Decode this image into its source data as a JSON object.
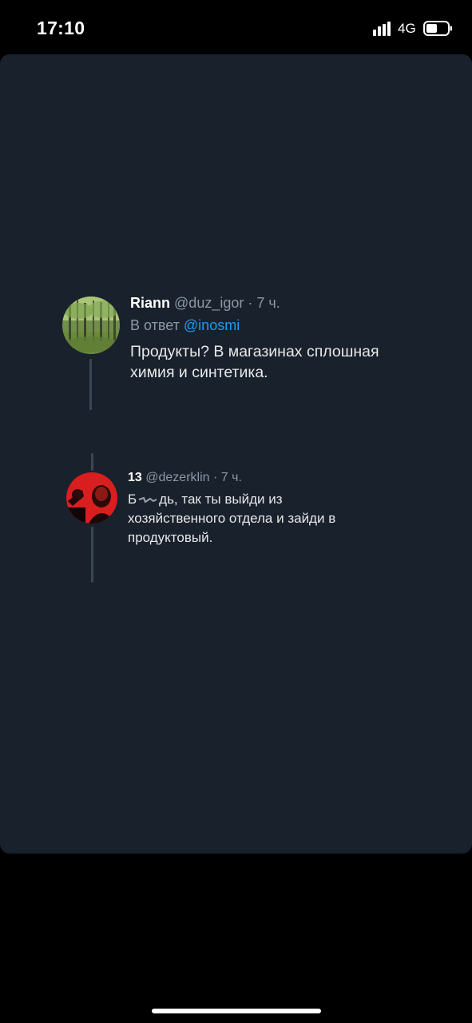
{
  "status_bar": {
    "time": "17:10",
    "network": "4G",
    "signal_icon": "signal-bars-icon",
    "battery_icon": "battery-icon"
  },
  "colors": {
    "background": "#000000",
    "card": "#19212c",
    "text_primary": "#e7e9ea",
    "text_secondary": "#8b98a5",
    "link": "#1d9bf0",
    "thread_line": "#3b4754"
  },
  "tweets": [
    {
      "name": "Riann",
      "handle": "@duz_igor",
      "separator": "·",
      "time": "7 ч.",
      "reply_prefix": "В ответ",
      "reply_to": "@inosmi",
      "text": "Продукты?  В магазинах сплошная химия и синтетика.",
      "avatar": "forest-photo-avatar"
    },
    {
      "name": "13",
      "handle": "@dezerklin",
      "separator": "·",
      "time": "7 ч.",
      "text_prefix": "Б",
      "text_rest": "дь, так ты выйди из хозяйственного отдела и зайди в продуктовый.",
      "avatar": "red-portrait-avatar"
    }
  ]
}
